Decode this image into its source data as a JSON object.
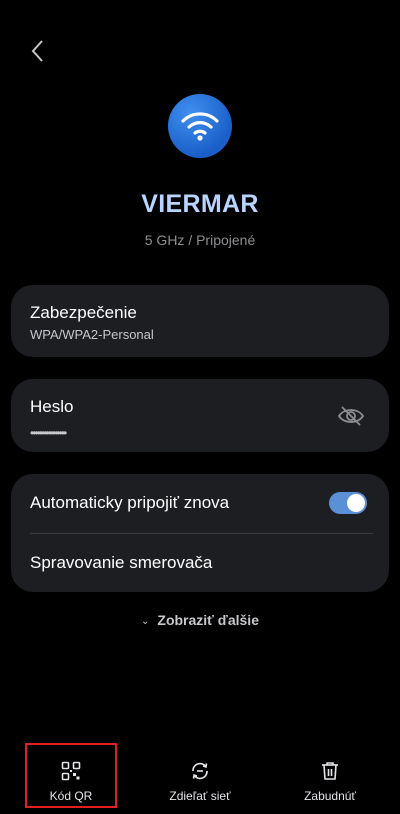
{
  "header": {
    "back_icon": "chevron-left-icon"
  },
  "network": {
    "icon": "wifi-icon",
    "ssid": "VIERMAR",
    "status": "5 GHz / Pripojené",
    "accent_color": "#1a5fc8"
  },
  "security": {
    "title": "Zabezpečenie",
    "value": "WPA/WPA2-Personal"
  },
  "password": {
    "title": "Heslo",
    "masked_value": "••••••••••••••••",
    "toggle_icon": "eye-off-icon"
  },
  "settings": {
    "auto_reconnect_label": "Automaticky pripojiť znova",
    "auto_reconnect_on": true,
    "router_manage_label": "Spravovanie smerovača"
  },
  "show_more": {
    "label": "Zobraziť ďalšie",
    "icon": "chevron-down-icon"
  },
  "bottom_bar": {
    "qr": {
      "label": "Kód QR",
      "icon": "qr-code-icon"
    },
    "share": {
      "label": "Zdieľať sieť",
      "icon": "share-network-icon"
    },
    "forget": {
      "label": "Zabudnúť",
      "icon": "trash-icon"
    }
  }
}
